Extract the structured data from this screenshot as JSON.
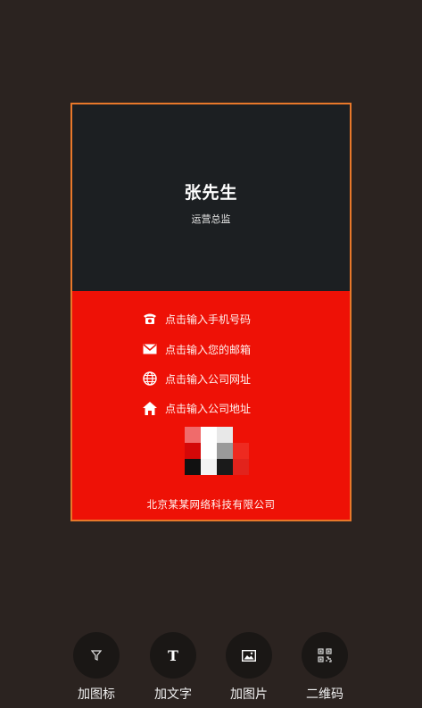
{
  "card": {
    "name": "张先生",
    "title": "运营总监",
    "phone_placeholder": "点击输入手机号码",
    "email_placeholder": "点击输入您的邮箱",
    "website_placeholder": "点击输入公司网址",
    "address_placeholder": "点击输入公司地址",
    "company": "北京某某网络科技有限公司"
  },
  "toolbar": {
    "add_icon": "加图标",
    "add_text": "加文字",
    "add_image": "加图片",
    "qr_code": "二维码"
  },
  "colors": {
    "background": "#2b2320",
    "card_top": "#1c1f22",
    "card_bottom": "#ee1106",
    "card_border": "#e8782a"
  },
  "icons": [
    "phone-icon",
    "mail-icon",
    "globe-icon",
    "home-icon",
    "filter-icon",
    "text-icon",
    "image-icon",
    "qr-icon"
  ]
}
